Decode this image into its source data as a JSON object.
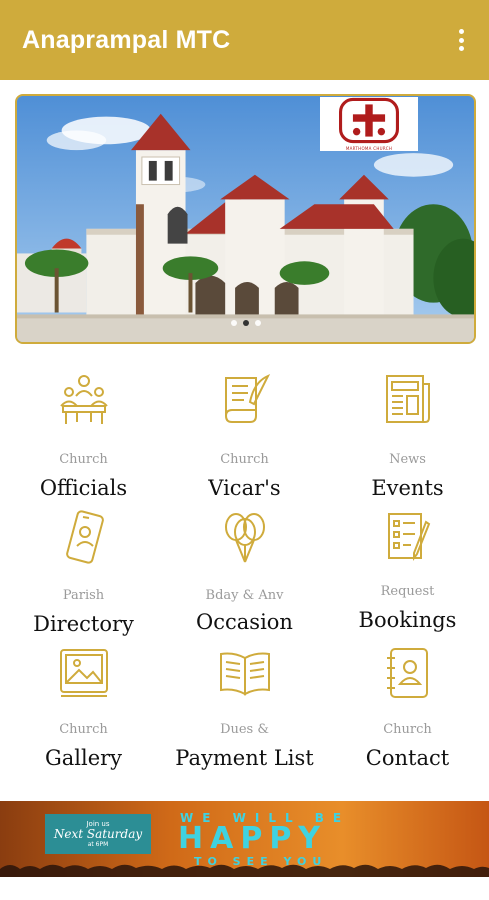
{
  "app": {
    "title": "Anaprampal MTC",
    "accent_color": "#cfab3c",
    "menu_icon": "more-vert-icon"
  },
  "banner": {
    "image": "church-building-photo",
    "logo_text": "MARTHOMA CHURCH",
    "slide_count": 3,
    "active_slide": 1
  },
  "menu": [
    {
      "sub": "Church",
      "main": "Officials",
      "icon": "officials-icon"
    },
    {
      "sub": "Church",
      "main": "Vicar's",
      "icon": "scroll-quill-icon"
    },
    {
      "sub": "News",
      "main": "Events",
      "icon": "newspaper-icon"
    },
    {
      "sub": "Parish",
      "main": "Directory",
      "icon": "phone-directory-icon"
    },
    {
      "sub": "Bday & Anv",
      "main": "Occasion",
      "icon": "balloons-icon"
    },
    {
      "sub": "Request",
      "main": "Bookings",
      "icon": "checklist-pen-icon"
    },
    {
      "sub": "Church",
      "main": "Gallery",
      "icon": "gallery-icon"
    },
    {
      "sub": "Dues &",
      "main": "Payment List",
      "icon": "open-book-icon"
    },
    {
      "sub": "Church",
      "main": "Contact",
      "icon": "contact-book-icon"
    }
  ],
  "ad": {
    "box_line1": "Join us",
    "box_line2": "Next Saturday",
    "box_line3": "at 6PM",
    "top": "WE WILL BE",
    "main": "HAPPY",
    "bottom": "TO SEE YOU"
  }
}
